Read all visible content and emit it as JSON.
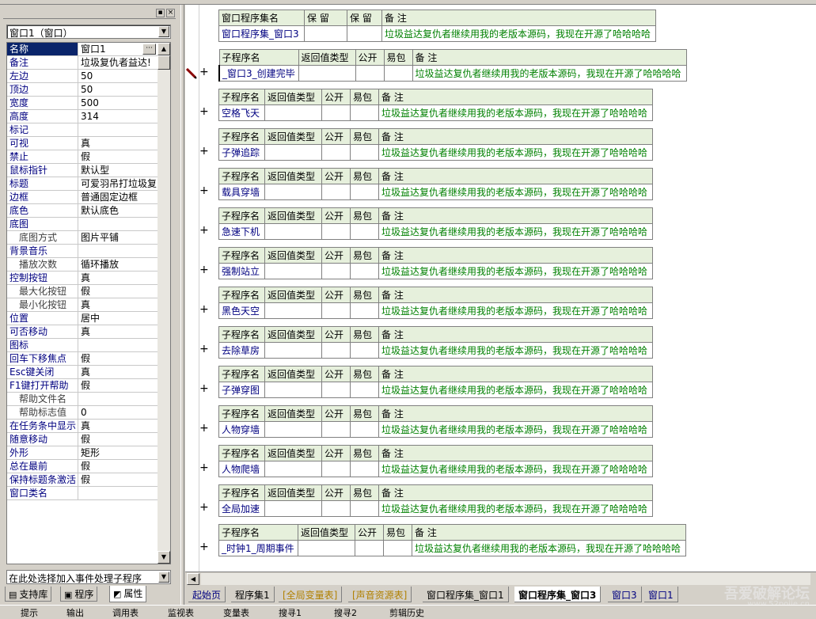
{
  "left_panel": {
    "window_select": "窗口1（窗口）",
    "properties": [
      {
        "name": "名称",
        "value": "窗口1",
        "selected": true,
        "sub": false
      },
      {
        "name": "备注",
        "value": "垃圾复仇者益达!",
        "sub": false
      },
      {
        "name": "左边",
        "value": "50",
        "sub": false
      },
      {
        "name": "顶边",
        "value": "50",
        "sub": false
      },
      {
        "name": "宽度",
        "value": "500",
        "sub": false
      },
      {
        "name": "高度",
        "value": "314",
        "sub": false
      },
      {
        "name": "标记",
        "value": "",
        "sub": false
      },
      {
        "name": "可视",
        "value": "真",
        "sub": false
      },
      {
        "name": "禁止",
        "value": "假",
        "sub": false
      },
      {
        "name": "鼠标指针",
        "value": "默认型",
        "sub": false
      },
      {
        "name": "标题",
        "value": "可爱羽吊打垃圾复",
        "sub": false
      },
      {
        "name": "边框",
        "value": "普通固定边框",
        "sub": false
      },
      {
        "name": "底色",
        "value": "默认底色",
        "sub": false
      },
      {
        "name": "底图",
        "value": "",
        "sub": false
      },
      {
        "name": "底图方式",
        "value": "图片平铺",
        "sub": true
      },
      {
        "name": "背景音乐",
        "value": "",
        "sub": false
      },
      {
        "name": "播放次数",
        "value": "循环播放",
        "sub": true
      },
      {
        "name": "控制按钮",
        "value": "真",
        "sub": false
      },
      {
        "name": "最大化按钮",
        "value": "假",
        "sub": true
      },
      {
        "name": "最小化按钮",
        "value": "真",
        "sub": true
      },
      {
        "name": "位置",
        "value": "居中",
        "sub": false
      },
      {
        "name": "可否移动",
        "value": "真",
        "sub": false
      },
      {
        "name": "图标",
        "value": "",
        "sub": false
      },
      {
        "name": "回车下移焦点",
        "value": "假",
        "sub": false
      },
      {
        "name": "Esc键关闭",
        "value": "真",
        "sub": false
      },
      {
        "name": "F1键打开帮助",
        "value": "假",
        "sub": false
      },
      {
        "name": "帮助文件名",
        "value": "",
        "sub": true
      },
      {
        "name": "帮助标志值",
        "value": "0",
        "sub": true
      },
      {
        "name": "在任务条中显示",
        "value": "真",
        "sub": false
      },
      {
        "name": "随意移动",
        "value": "假",
        "sub": false
      },
      {
        "name": "外形",
        "value": "矩形",
        "sub": false
      },
      {
        "name": "总在最前",
        "value": "假",
        "sub": false
      },
      {
        "name": "保持标题条激活",
        "value": "假",
        "sub": false
      },
      {
        "name": "窗口类名",
        "value": "",
        "sub": false
      }
    ],
    "event_select": "在此处选择加入事件处理子程序",
    "tabs": [
      "支持库",
      "程序",
      "属性"
    ]
  },
  "editor": {
    "assembly_header": {
      "name": "窗口程序集名",
      "reserved1": "保 留",
      "reserved2": "保 留",
      "note": "备 注"
    },
    "assembly_row": {
      "name": "窗口程序集_窗口3",
      "note": "垃圾益达复仇者继续用我的老版本源码，我现在开源了哈哈哈哈"
    },
    "sub_header": {
      "name": "子程序名",
      "ret": "返回值类型",
      "public": "公开",
      "easy": "易包",
      "note": "备 注"
    },
    "common_note": "垃圾益达复仇者继续用我的老版本源码，我现在开源了哈哈哈哈",
    "subs": [
      "_窗口3_创建完毕",
      "空格飞天",
      "子弹追踪",
      "载具穿墙",
      "急速下机",
      "强制站立",
      "黑色天空",
      "去除草房",
      "子弹穿图",
      "人物穿墙",
      "人物爬墙",
      "全局加速",
      "_时钟1_周期事件"
    ],
    "plus": "+"
  },
  "doc_tabs": [
    "起始页",
    "程序集1",
    "[全局变量表]",
    "[声音资源表]",
    "窗口程序集_窗口1",
    "窗口程序集_窗口3",
    "窗口3",
    "窗口1"
  ],
  "status_items": [
    "提示",
    "输出",
    "调用表",
    "监视表",
    "变量表",
    "搜寻1",
    "搜寻2",
    "剪辑历史"
  ],
  "watermark": "吾爱破解论坛",
  "watermark_url": "www.52pojie.cn"
}
